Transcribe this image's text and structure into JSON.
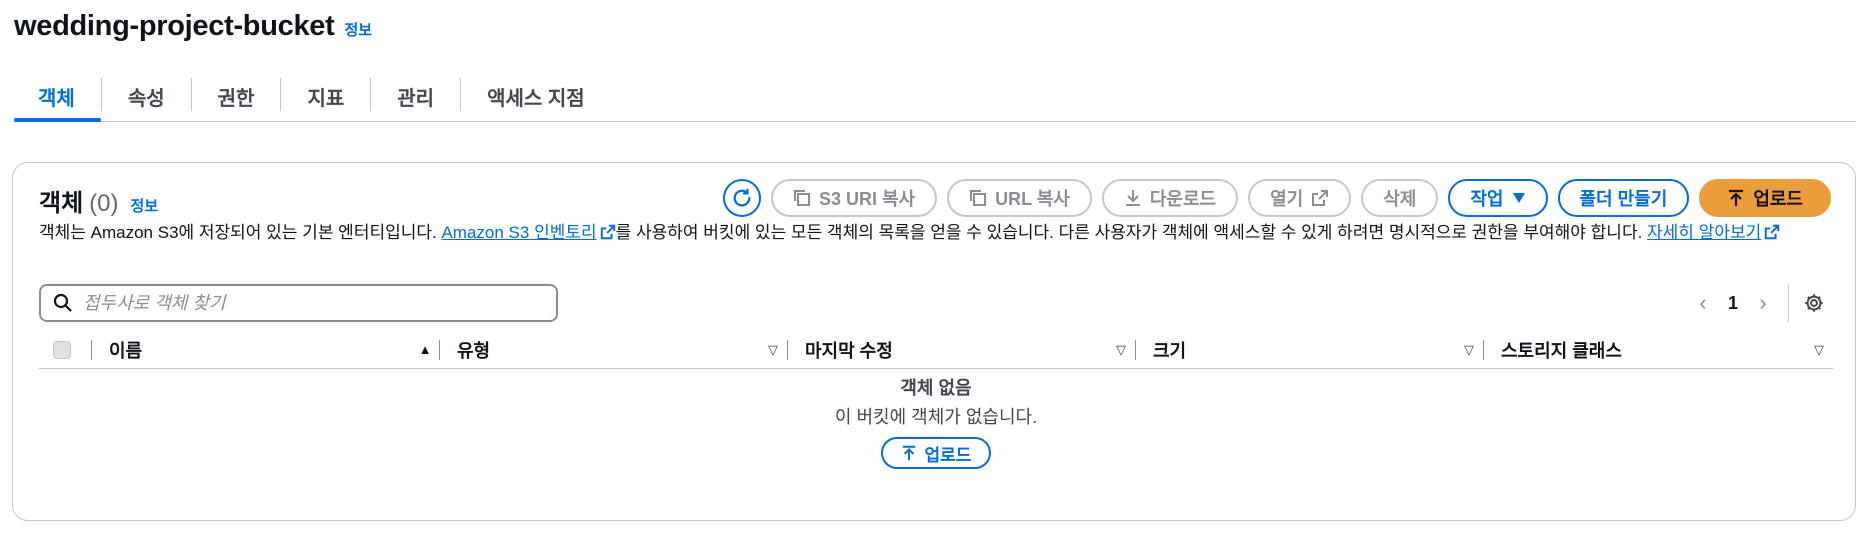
{
  "header": {
    "title": "wedding-project-bucket",
    "info": "정보"
  },
  "tabs": [
    {
      "label": "객체"
    },
    {
      "label": "속성"
    },
    {
      "label": "권한"
    },
    {
      "label": "지표"
    },
    {
      "label": "관리"
    },
    {
      "label": "액세스 지점"
    }
  ],
  "objects_panel": {
    "title": "객체",
    "count": "(0)",
    "info": "정보",
    "description": {
      "part1": "객체는 Amazon S3에 저장되어 있는 기본 엔터티입니다. ",
      "inventory_link": "Amazon S3 인벤토리",
      "part2": "를 사용하여 버킷에 있는 모든 객체의 목록을 얻을 수 있습니다. 다른 사용자가 객체에 액세스할 수 있게 하려면 명시적으로 권한을 부여해야 합니다. ",
      "learn_more": "자세히 알아보기"
    },
    "actions": {
      "copy_s3_uri": "S3 URI 복사",
      "copy_url": "URL 복사",
      "download": "다운로드",
      "open": "열기",
      "delete": "삭제",
      "actions_menu": "작업",
      "create_folder": "폴더 만들기",
      "upload": "업로드"
    },
    "search": {
      "placeholder": "접두사로 객체 찾기",
      "value": ""
    },
    "pagination": {
      "current_page": "1"
    },
    "columns": [
      "이름",
      "유형",
      "마지막 수정",
      "크기",
      "스토리지 클래스"
    ],
    "empty_state": {
      "title": "객체 없음",
      "subtitle": "이 버킷에 객체가 없습니다.",
      "button": "업로드"
    }
  },
  "colors": {
    "accent": "#006ce0",
    "upload": "#ec9d3b",
    "disabled": "#8c8c94"
  },
  "icons": [
    "refresh-icon",
    "copy-icon",
    "download-icon",
    "external-link-icon",
    "caret-down-icon",
    "upload-arrow-icon",
    "search-icon",
    "chevron-left-icon",
    "chevron-right-icon",
    "gear-icon",
    "sort-ascending-icon",
    "sort-icon"
  ]
}
